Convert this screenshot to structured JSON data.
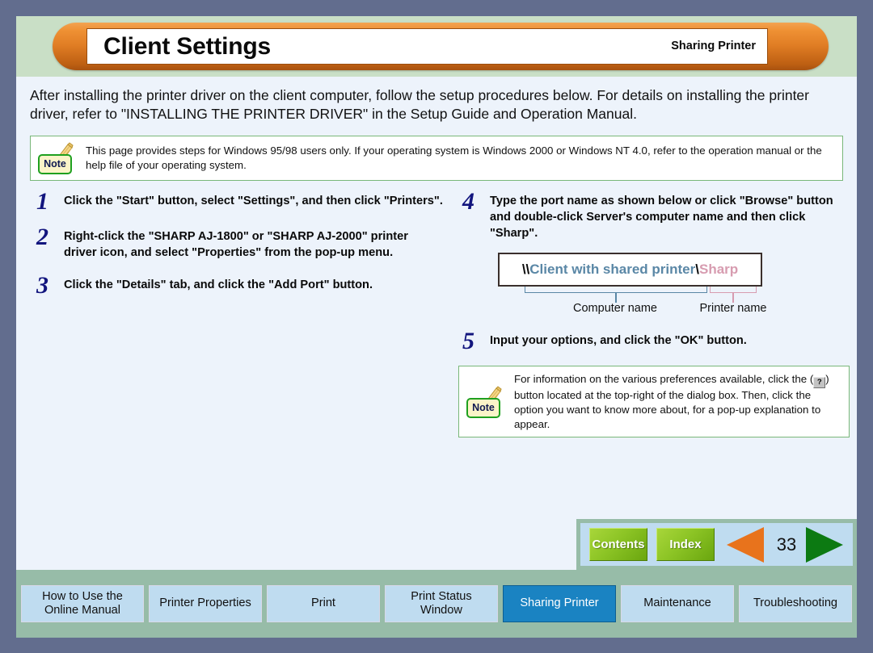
{
  "header": {
    "title": "Client Settings",
    "section": "Sharing Printer"
  },
  "intro": "After installing the printer driver on the client computer, follow the setup procedures below. For details on installing the printer driver, refer to \"INSTALLING THE PRINTER DRIVER\" in the Setup Guide and Operation Manual.",
  "notes": {
    "label": "Note",
    "top": "This page provides steps for Windows 95/98 users only. If your operating system is Windows 2000 or Windows NT 4.0, refer to the operation manual or the help file of your operating system.",
    "bottom_part1": "For information on the various preferences available, click the (",
    "bottom_button": "?",
    "bottom_part2": ") button located at the top-right of the dialog box. Then, click the option you want to know more about, for a pop-up explanation to appear."
  },
  "steps_left": [
    {
      "num": "1",
      "text": "Click the \"Start\" button, select \"Settings\", and then click \"Printers\"."
    },
    {
      "num": "2",
      "text": "Right-click the \"SHARP AJ-1800\" or \"SHARP AJ-2000\" printer driver icon, and select \"Properties\" from the pop-up menu."
    },
    {
      "num": "3",
      "text": "Click the \"Details\" tab, and click the \"Add Port\" button."
    }
  ],
  "steps_right": [
    {
      "num": "4",
      "text": "Type the port name as shown below or click \"Browse\" button and double-click Server's computer name and then click \"Sharp\"."
    },
    {
      "num": "5",
      "text": "Input your options, and click the \"OK\" button."
    }
  ],
  "port_diagram": {
    "lead_slashes": "\\\\",
    "computer_name": "Client with shared printer",
    "separator": "\\",
    "printer_name": "Sharp",
    "computer_caption": "Computer name",
    "printer_caption": "Printer name"
  },
  "pager": {
    "contents_label": "Contents",
    "index_label": "Index",
    "page_number": "33",
    "prev_icon": "left-triangle-icon",
    "next_icon": "right-triangle-icon"
  },
  "tabs": [
    {
      "label": "How to Use the Online Manual",
      "active": false
    },
    {
      "label": "Printer Properties",
      "active": false
    },
    {
      "label": "Print",
      "active": false
    },
    {
      "label": "Print Status Window",
      "active": false
    },
    {
      "label": "Sharing Printer",
      "active": true
    },
    {
      "label": "Maintenance",
      "active": false
    },
    {
      "label": "Troubleshooting",
      "active": false
    }
  ],
  "colors": {
    "frame": "#626d8e",
    "header_band": "#c9dfc6",
    "content": "#edf3fb",
    "capsule_orange": "#e07d24",
    "active_tab": "#1a83c2",
    "tab": "#bfdcf0",
    "tab_band": "#97bca8",
    "step_number": "#12157e",
    "computer_name": "#5a87a6",
    "printer_name": "#d79cb0",
    "note_border": "#79b779"
  }
}
